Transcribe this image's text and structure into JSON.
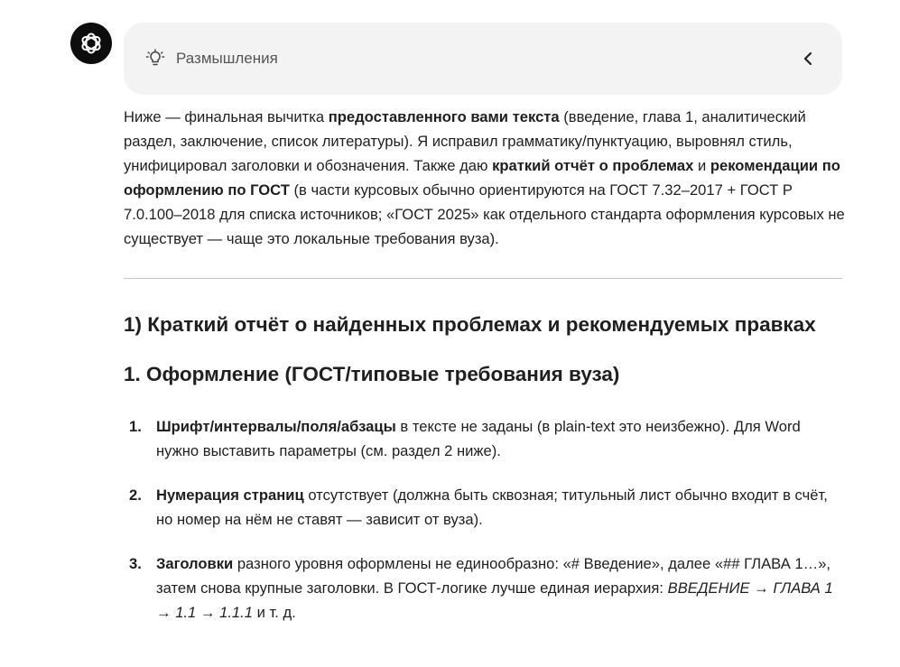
{
  "thinking": {
    "label": "Размышления",
    "icon": "lightbulb-icon",
    "toggle_icon": "chevron-left-icon"
  },
  "message": {
    "intro": [
      {
        "t": "Ниже — финальная вычитка ",
        "b": false
      },
      {
        "t": "предоставленного вами текста",
        "b": true
      },
      {
        "t": " (введение, глава 1, аналитический раздел, заключение, список литературы). Я исправил грамматику/пунктуацию, выровнял стиль, унифицировал заголовки и обозначения. Также даю ",
        "b": false
      },
      {
        "t": "краткий отчёт о проблемах",
        "b": true
      },
      {
        "t": " и ",
        "b": false
      },
      {
        "t": "рекомендации по оформлению по ГОСТ",
        "b": true
      },
      {
        "t": " (в части курсовых обычно ориентируются на ГОСТ 7.32–2017 + ГОСТ Р 7.0.100–2018 для списка источников; «ГОСТ 2025» как отдельного стандарта оформления курсовых не существует — чаще это локальные требования вуза).",
        "b": false
      }
    ],
    "heading_report": "1) Краткий отчёт о найденных проблемах и рекомендуемых правках",
    "heading_format": "1. Оформление (ГОСТ/типовые требования вуза)",
    "items": [
      {
        "num": "1.",
        "parts": [
          {
            "t": "Шрифт/интервалы/поля/абзацы",
            "s": "b"
          },
          {
            "t": " в тексте не заданы (в plain-text это неизбежно). Для Word нужно выставить параметры (см. раздел 2 ниже).",
            "s": ""
          }
        ]
      },
      {
        "num": "2.",
        "parts": [
          {
            "t": "Нумерация страниц",
            "s": "b"
          },
          {
            "t": " отсутствует (должна быть сквозная; титульный лист обычно входит в счёт, но номер на нём не ставят — зависит от вуза).",
            "s": ""
          }
        ]
      },
      {
        "num": "3.",
        "parts": [
          {
            "t": "Заголовки",
            "s": "b"
          },
          {
            "t": " разного уровня оформлены не единообразно: «# Введение», далее «## ГЛАВА 1…», затем снова крупные заголовки. В ГОСТ-логике лучше единая иерархия: ",
            "s": ""
          },
          {
            "t": "ВВЕДЕНИЕ → ГЛАВА 1 → 1.1 → 1.1.1",
            "s": "i"
          },
          {
            "t": " и т. д.",
            "s": ""
          }
        ]
      }
    ]
  }
}
